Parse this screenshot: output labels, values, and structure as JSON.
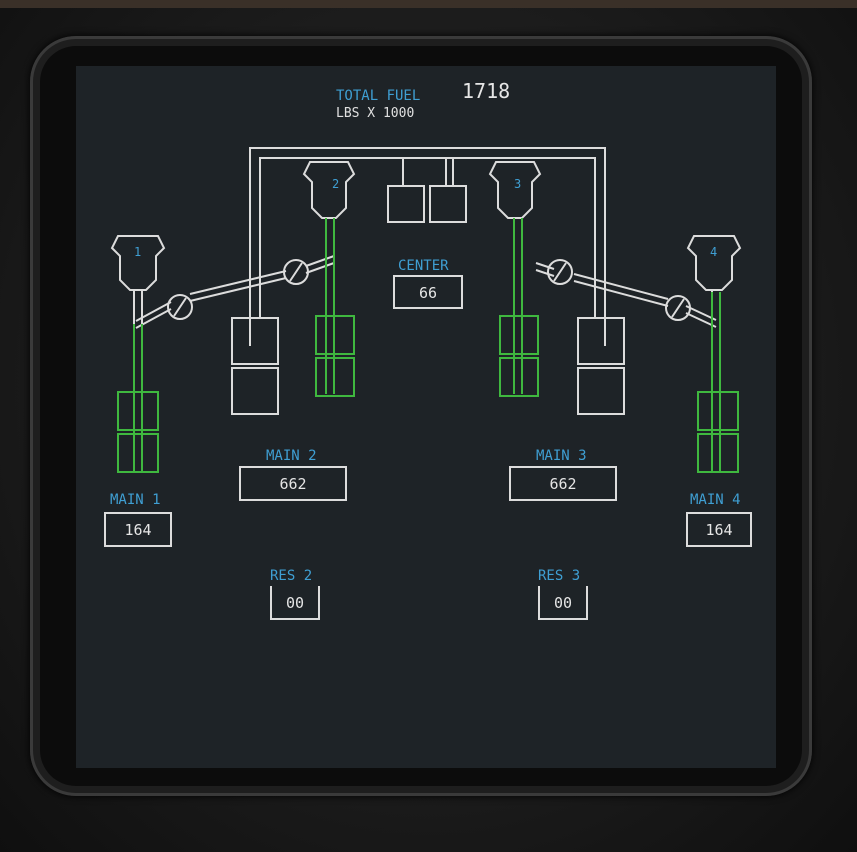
{
  "header": {
    "total_fuel_label": "TOTAL FUEL",
    "total_fuel_value": "1718",
    "units_label": "LBS X 1000"
  },
  "tanks": {
    "center": {
      "label": "CENTER",
      "value": "66"
    },
    "main1": {
      "label": "MAIN 1",
      "value": "164"
    },
    "main2": {
      "label": "MAIN 2",
      "value": "662"
    },
    "main3": {
      "label": "MAIN 3",
      "value": "662"
    },
    "main4": {
      "label": "MAIN 4",
      "value": "164"
    },
    "res2": {
      "label": "RES 2",
      "value": "00"
    },
    "res3": {
      "label": "RES 3",
      "value": "00"
    }
  },
  "engines": [
    "1",
    "2",
    "3",
    "4"
  ],
  "colors": {
    "label": "#3f9fd3",
    "value": "#e6e6e6",
    "line_white": "#dcdcdc",
    "pump_on": "#3fb83f",
    "screen_bg": "#1e2327"
  }
}
